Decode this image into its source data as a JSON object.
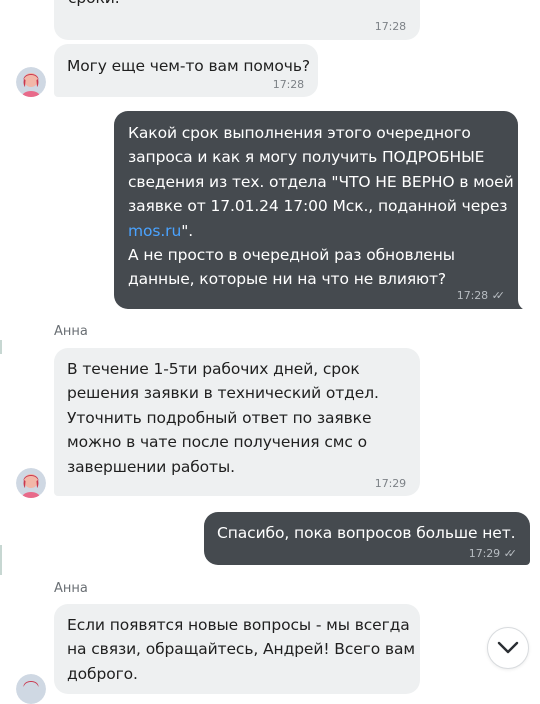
{
  "messages": [
    {
      "id": "m1",
      "direction": "incoming",
      "text": "сроки.",
      "time": "17:28"
    },
    {
      "id": "m2",
      "direction": "incoming",
      "text": "Могу еще чем-то вам помочь?",
      "time": "17:28"
    },
    {
      "id": "m3",
      "direction": "outgoing",
      "lines": [
        "Какой срок выполнения этого очередного",
        "запроса и как я могу получить ПОДРОБНЫЕ",
        "сведения из тех. отдела \"ЧТО НЕ ВЕРНО в моей",
        "заявке от 17.01.24 17:00 Мск., поданной через"
      ],
      "link": "mos.ru",
      "link_suffix": "\".",
      "lines_after": [
        "А не просто в очередной раз обновлены",
        "данные, которые ни на что не влияют?"
      ],
      "time": "17:28",
      "status": "read"
    },
    {
      "id": "m4",
      "direction": "incoming",
      "sender": "Анна",
      "lines": [
        "В течение 1-5ти рабочих дней, срок",
        "решения заявки в технический отдел.",
        "Уточнить подробный ответ по заявке",
        "можно в чате после получения смс о",
        "завершении работы."
      ],
      "time": "17:29"
    },
    {
      "id": "m5",
      "direction": "outgoing",
      "text": "Спасибо, пока вопросов больше нет.",
      "time": "17:29",
      "status": "read"
    },
    {
      "id": "m6",
      "direction": "incoming",
      "sender": "Анна",
      "lines": [
        "Если появятся новые вопросы - мы всегда",
        "на связи, обращайтесь, Андрей! Всего вам",
        "доброго."
      ]
    }
  ],
  "icons": {
    "avatar": "agent-avatar-icon",
    "read_status": "double-check-icon",
    "scroll_down": "chevron-down-icon"
  },
  "colors": {
    "incoming_bubble": "#eef0f1",
    "outgoing_bubble": "#454a4f",
    "link": "#4aa3ff",
    "timestamp": "#7d8287"
  }
}
